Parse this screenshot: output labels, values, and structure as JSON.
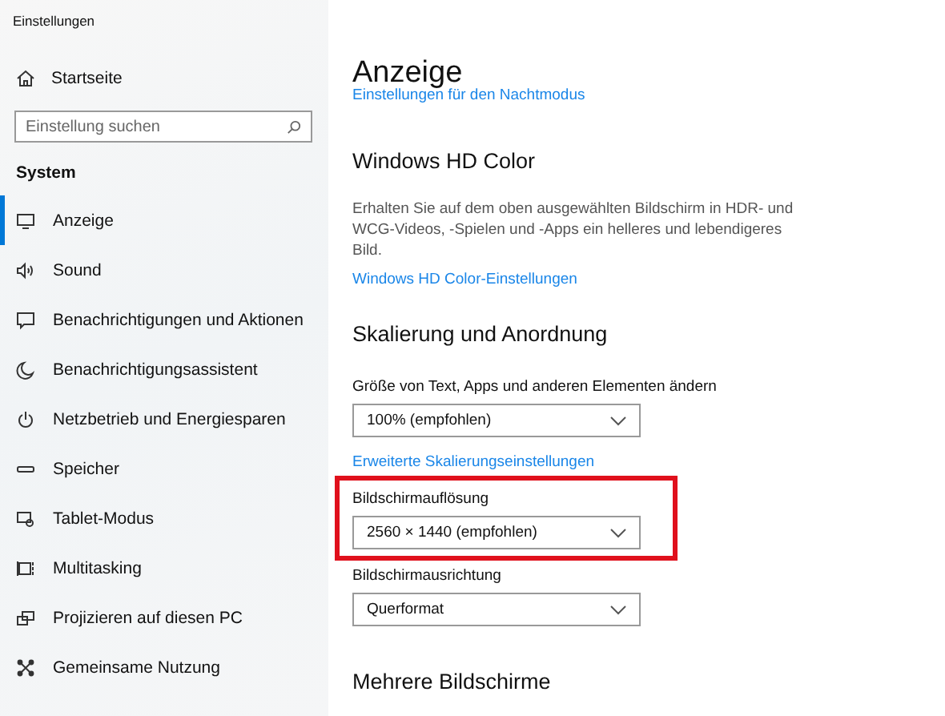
{
  "window": {
    "title": "Einstellungen"
  },
  "sidebar": {
    "home": "Startseite",
    "search": {
      "placeholder": "Einstellung suchen"
    },
    "section": "System",
    "items": [
      {
        "label": "Anzeige",
        "selected": true
      },
      {
        "label": "Sound",
        "selected": false
      },
      {
        "label": "Benachrichtigungen und Aktionen",
        "selected": false
      },
      {
        "label": "Benachrichtigungsassistent",
        "selected": false
      },
      {
        "label": "Netzbetrieb und Energiesparen",
        "selected": false
      },
      {
        "label": "Speicher",
        "selected": false
      },
      {
        "label": "Tablet-Modus",
        "selected": false
      },
      {
        "label": "Multitasking",
        "selected": false
      },
      {
        "label": "Projizieren auf diesen PC",
        "selected": false
      },
      {
        "label": "Gemeinsame Nutzung",
        "selected": false
      }
    ]
  },
  "page": {
    "title": "Anzeige",
    "top_link": "Einstellungen für den Nachtmodus",
    "sections": [
      {
        "heading": "Windows HD Color",
        "description": "Erhalten Sie auf dem oben ausgewählten Bildschirm in HDR- und WCG-Videos, -Spielen und -Apps ein helleres und lebendigeres Bild.",
        "link": "Windows HD Color-Einstellungen"
      },
      {
        "heading": "Skalierung und Anordnung",
        "settings": [
          {
            "label": "Größe von Text, Apps und anderen Elementen ändern",
            "value": "100% (empfohlen)",
            "link": "Erweiterte Skalierungseinstellungen",
            "highlighted": false
          },
          {
            "label": "Bildschirmauflösung",
            "value": "2560 × 1440 (empfohlen)",
            "highlighted": true
          },
          {
            "label": "Bildschirmausrichtung",
            "value": "Querformat",
            "highlighted": false
          }
        ]
      },
      {
        "heading": "Mehrere Bildschirme"
      }
    ]
  }
}
